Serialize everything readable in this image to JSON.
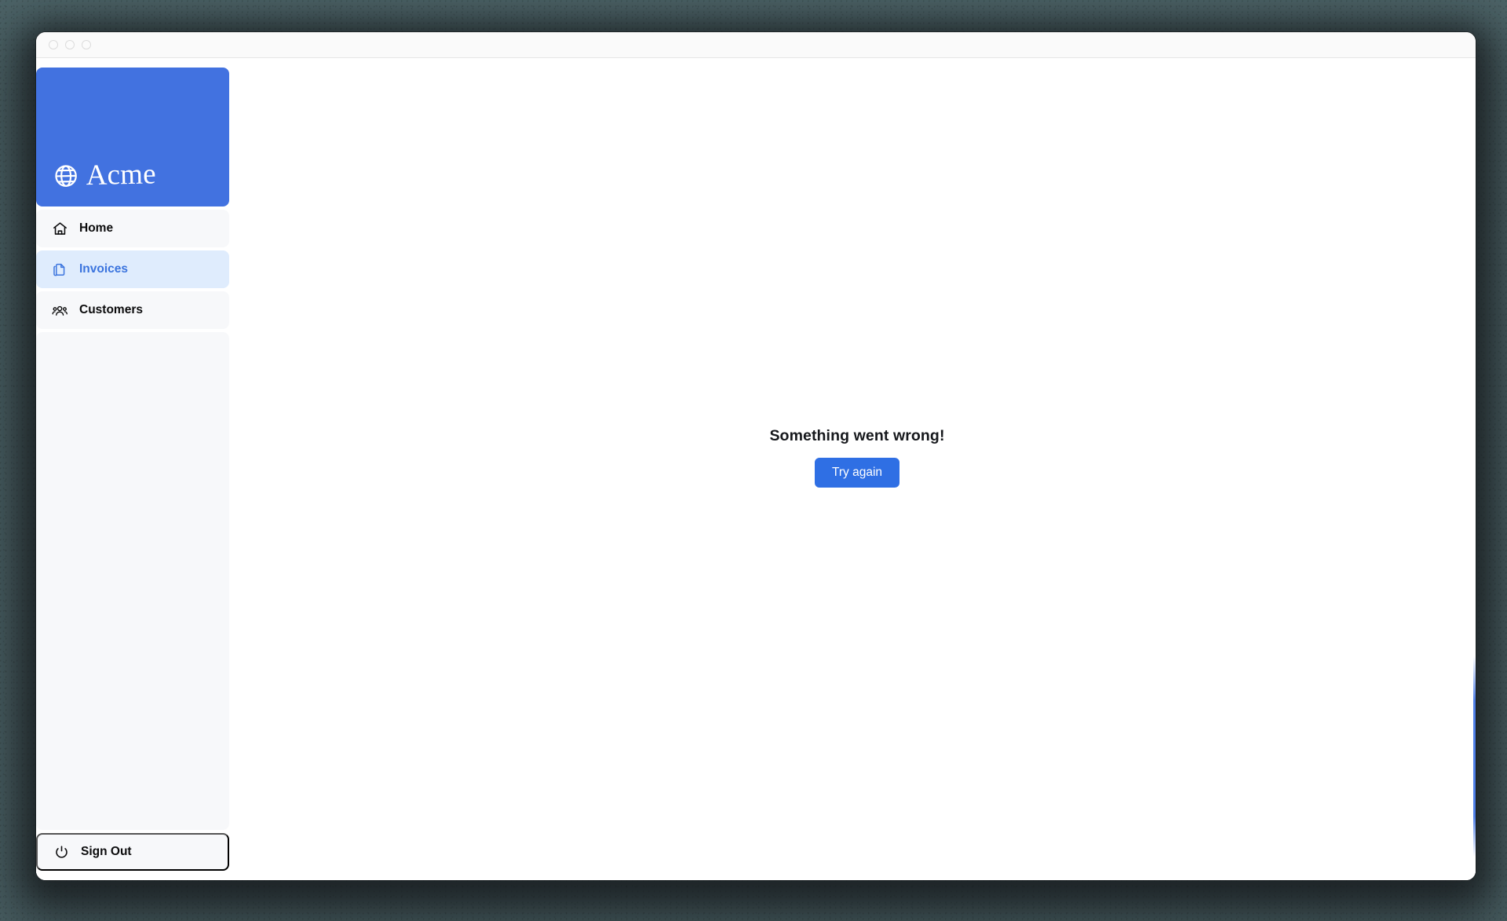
{
  "window": {
    "traffic_lights": [
      "close",
      "minimize",
      "maximize"
    ]
  },
  "sidebar": {
    "brand": {
      "name": "Acme",
      "icon": "globe-icon",
      "background_color": "#4272e0"
    },
    "items": [
      {
        "label": "Home",
        "icon": "home-icon",
        "active": false
      },
      {
        "label": "Invoices",
        "icon": "document-duplicate-icon",
        "active": true
      },
      {
        "label": "Customers",
        "icon": "user-group-icon",
        "active": false
      }
    ],
    "signout": {
      "label": "Sign Out",
      "icon": "power-icon"
    },
    "active_color": "#3b74de",
    "active_background": "#dfecfd",
    "item_background": "#f7f8fa"
  },
  "main": {
    "error": {
      "title": "Something went wrong!",
      "retry_label": "Try again",
      "retry_color": "#2f6fe4"
    }
  }
}
